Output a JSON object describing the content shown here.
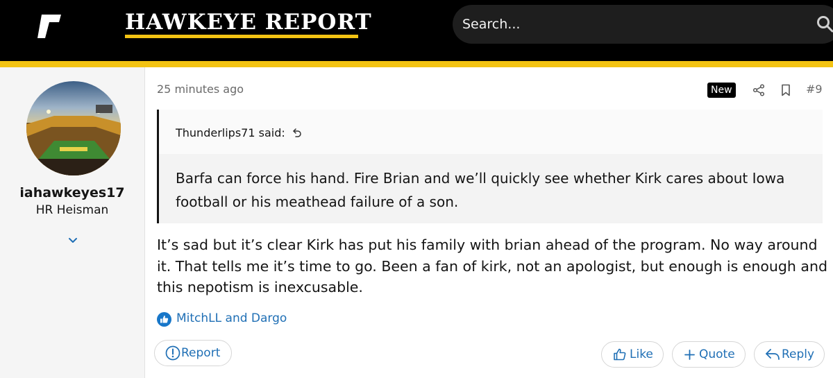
{
  "header": {
    "brand": "HAWKEYE REPORT",
    "search_placeholder": "Search..."
  },
  "user": {
    "username": "iahawkeyes17",
    "title": "HR Heisman"
  },
  "post": {
    "time": "25 minutes ago",
    "badge": "New",
    "number": "#9",
    "quote_author": "Thunderlips71 said:",
    "quote_text": "Barfa can force his hand. Fire Brian and we’ll quickly see whether Kirk cares about Iowa football or his meathead failure of a son.",
    "message": "It’s sad but it’s clear Kirk has put his family with brian ahead of the program. No way around it. That tells me it’s time to go. Been a fan of kirk, not an apologist, but enough is enough and this nepotism is inexcusable.",
    "reactions": "MitchLL and Dargo"
  },
  "actions": {
    "report": "Report",
    "like": "Like",
    "quote": "Quote",
    "reply": "Reply"
  },
  "colors": {
    "gold": "#f3c313",
    "header_bg": "#000000",
    "link": "#1f6fb5",
    "like_blue": "#1877c9"
  },
  "icons": [
    "rivals-logo-icon",
    "search-icon",
    "chevron-down-icon",
    "share-icon",
    "bookmark-icon",
    "return-arrow-icon",
    "like-reaction-icon",
    "report-icon",
    "thumbs-up-icon",
    "plus-icon",
    "reply-icon"
  ]
}
